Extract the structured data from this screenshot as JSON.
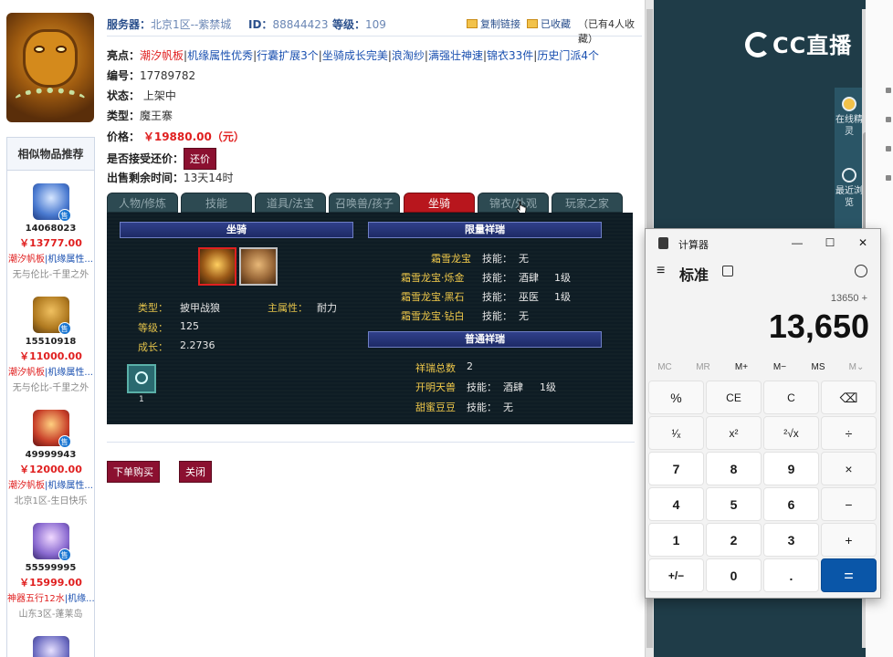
{
  "item": {
    "server_label": "服务器：",
    "server_value": "北京1区--紫禁城",
    "id_label": "ID：",
    "id_value": "88844423",
    "level_label": "等级：",
    "level_value": "109",
    "copy_link": "复制链接",
    "favorited": "已收藏",
    "fav_count": "（已有4人收藏）",
    "highlights_label": "亮点：",
    "highlights": [
      "潮汐帆板",
      "机缘属性优秀",
      "行囊扩展3个",
      "坐骑成长完美",
      "浪淘纱",
      "满强壮神速",
      "锦衣33件",
      "历史门派4个"
    ],
    "number_label": "编号：",
    "number_value": "17789782",
    "status_label": "状态：",
    "status_value": "上架中",
    "type_label": "类型：",
    "type_value": "魔王寨",
    "price_label": "价格：",
    "price_value": "￥19880.00（元）",
    "bargain_label": "是否接受还价：",
    "bargain_button": "还价",
    "time_label": "出售剩余时间：",
    "time_value": "13天14时",
    "buy_button": "下单购买",
    "close_button": "关闭"
  },
  "tabs": [
    "人物/修炼",
    "技能",
    "道具/法宝",
    "召唤兽/孩子",
    "坐骑",
    "锦衣/外观",
    "玩家之家"
  ],
  "active_tab": "坐骑",
  "mount_panel": {
    "mount_header": "坐骑",
    "limited_header": "限量祥瑞",
    "normal_header": "普通祥瑞",
    "type_label": "类型：",
    "type_value": "披甲战狼",
    "main_attr_label": "主属性：",
    "main_attr_value": "耐力",
    "level_label": "等级：",
    "level_value": "125",
    "growth_label": "成长：",
    "growth_value": "2.2736",
    "skill_count": "1",
    "limited": [
      {
        "name": "霜雪龙宝",
        "skill": "技能：",
        "skill_value": "无",
        "level": ""
      },
      {
        "name": "霜雪龙宝·烁金",
        "skill": "技能：",
        "skill_value": "酒肆",
        "level": "1级"
      },
      {
        "name": "霜雪龙宝·黑石",
        "skill": "技能：",
        "skill_value": "巫医",
        "level": "1级"
      },
      {
        "name": "霜雪龙宝·钻白",
        "skill": "技能：",
        "skill_value": "无",
        "level": ""
      }
    ],
    "normal_total_label": "祥瑞总数",
    "normal_total_value": "2",
    "normal": [
      {
        "name": "开明天兽",
        "skill": "技能：",
        "skill_value": "酒肆",
        "level": "1级"
      },
      {
        "name": "甜蜜豆豆",
        "skill": "技能：",
        "skill_value": "无",
        "level": ""
      }
    ]
  },
  "recommend": {
    "title": "相似物品推荐",
    "sell_badge": "售",
    "items": [
      {
        "id": "14068023",
        "price": "￥13777.00",
        "tag_red": "潮汐帆板",
        "tag_blue": "|机缘属性...",
        "server": "无与伦比-千里之外",
        "icon_color": "#4a7ad0"
      },
      {
        "id": "15510918",
        "price": "￥11000.00",
        "tag_red": "潮汐帆板",
        "tag_blue": "|机缘属性...",
        "server": "无与伦比-千里之外",
        "icon_color": "#b07a20"
      },
      {
        "id": "49999943",
        "price": "￥12000.00",
        "tag_red": "潮汐帆板",
        "tag_blue": "|机缘属性...",
        "server": "北京1区-生日快乐",
        "icon_color": "#c8402a"
      },
      {
        "id": "55599995",
        "price": "￥15999.00",
        "tag_red": "神器五行12水",
        "tag_blue": "|机缘...",
        "server": "山东3区-蓬莱岛",
        "icon_color": "#8a6ad0"
      }
    ]
  },
  "cc": {
    "logo_text": "CC直播",
    "side_items": [
      "在线精灵",
      "最近浏览"
    ]
  },
  "calculator": {
    "app_title": "计算器",
    "mode": "标准",
    "expression": "13650 +",
    "display": "13,650",
    "memory": [
      "MC",
      "MR",
      "M+",
      "M−",
      "MS",
      "M⌄"
    ],
    "keys": [
      [
        "%",
        "CE",
        "C",
        "⌫"
      ],
      [
        "¹⁄ₓ",
        "x²",
        "²√x",
        "÷"
      ],
      [
        "7",
        "8",
        "9",
        "×"
      ],
      [
        "4",
        "5",
        "6",
        "−"
      ],
      [
        "1",
        "2",
        "3",
        "+"
      ],
      [
        "+/−",
        "0",
        ".",
        "="
      ]
    ],
    "minimize": "—",
    "maximize": "☐",
    "close": "✕"
  }
}
